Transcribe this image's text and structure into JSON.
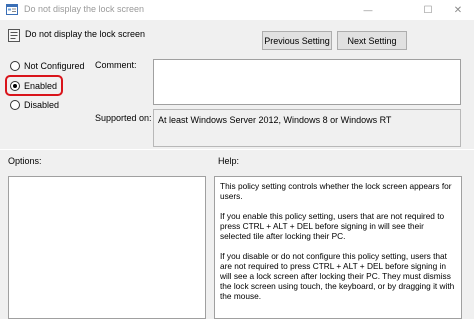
{
  "window": {
    "title": "Do not display the lock screen",
    "minimize": "—",
    "maximize": "☐",
    "close": "✕"
  },
  "header": {
    "setting_name": "Do not display the lock screen",
    "previous_button": "Previous Setting",
    "next_button": "Next Setting"
  },
  "state": {
    "options": [
      {
        "label": "Not Configured",
        "selected": false
      },
      {
        "label": "Enabled",
        "selected": true
      },
      {
        "label": "Disabled",
        "selected": false
      }
    ]
  },
  "comment": {
    "label": "Comment:",
    "value": ""
  },
  "supported": {
    "label": "Supported on:",
    "value": "At least Windows Server 2012, Windows 8 or Windows RT"
  },
  "options_panel": {
    "label": "Options:"
  },
  "help_panel": {
    "label": "Help:",
    "paragraphs": [
      "This policy setting controls whether the lock screen appears for users.",
      "If you enable this policy setting, users that are not required to press CTRL + ALT + DEL before signing in will see their selected tile after  locking their PC.",
      "If you disable or do not configure this policy setting, users that are not required to press CTRL + ALT + DEL before signing in will see a lock screen after locking their PC. They must dismiss the lock screen using touch, the keyboard, or by dragging it with the mouse."
    ]
  },
  "colors": {
    "highlight": "#d9141b",
    "background": "#f0f0f0"
  }
}
